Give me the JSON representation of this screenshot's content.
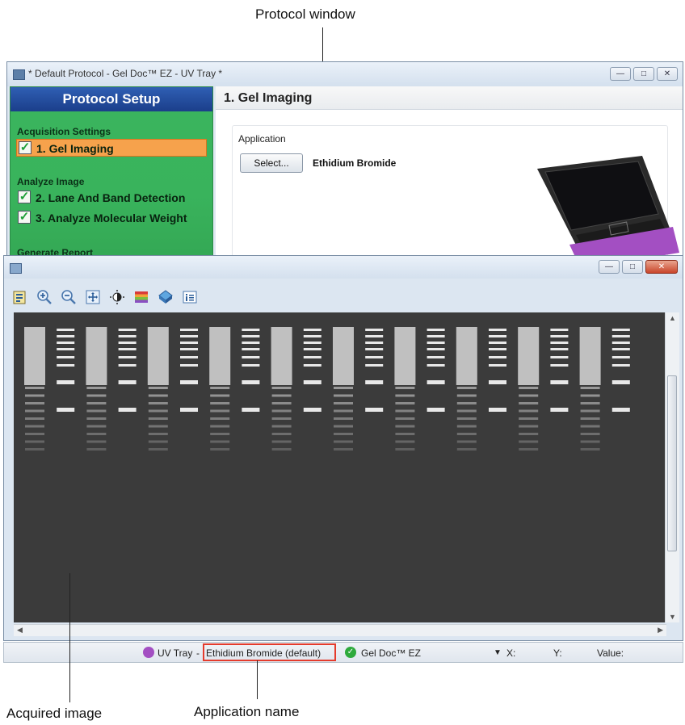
{
  "callouts": {
    "protocol_window": "Protocol window",
    "acquired_image": "Acquired image",
    "application_name": "Application name"
  },
  "protocol_window": {
    "title": "* Default Protocol - Gel Doc™ EZ - UV Tray *",
    "sidebar": {
      "header": "Protocol Setup",
      "sections": [
        {
          "label": "Acquisition Settings"
        },
        {
          "label": "Analyze Image"
        },
        {
          "label": "Generate Report"
        }
      ],
      "items": [
        {
          "label": "1. Gel Imaging",
          "checked": true,
          "selected": true
        },
        {
          "label": "2. Lane And Band Detection",
          "checked": true,
          "selected": false
        },
        {
          "label": "3. Analyze Molecular Weight",
          "checked": true,
          "selected": false
        }
      ]
    },
    "main": {
      "title": "1. Gel Imaging",
      "application_label": "Application",
      "select_button": "Select...",
      "application_value": "Ethidium Bromide"
    }
  },
  "image_window": {
    "toolbar_icons": [
      "image-properties-icon",
      "zoom-in-icon",
      "zoom-out-icon",
      "fit-to-window-icon",
      "contrast-icon",
      "color-palette-icon",
      "3d-view-icon",
      "info-icon"
    ],
    "gel_lane_count": 20
  },
  "statusbar": {
    "tray": "UV Tray",
    "separator": " - ",
    "application": "Ethidium Bromide (default)",
    "instrument": "Gel Doc™ EZ",
    "x_label": "X:",
    "y_label": "Y:",
    "value_label": "Value:"
  },
  "colors": {
    "sidebar_green": "#39b35c",
    "sidebar_header_blue": "#1f4a9a",
    "selected_orange": "#f6a24c",
    "highlight_red": "#e53b2c",
    "tray_purple": "#a34fc2",
    "status_ok_green": "#2eaa3c"
  }
}
